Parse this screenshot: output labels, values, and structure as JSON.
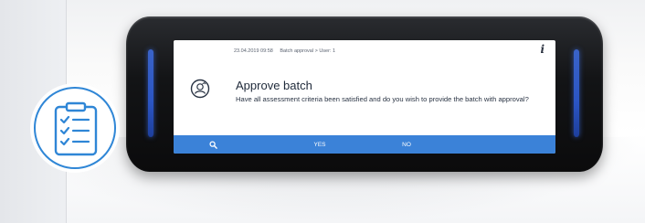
{
  "screen": {
    "status": {
      "datetime": "23.04.2019 09:58",
      "context": "Batch approval > User: 1"
    },
    "info_icon": "i",
    "dialog": {
      "icon": "user-approval-icon",
      "title": "Approve batch",
      "message": "Have all assessment criteria been satisfied and do you wish to provide the batch with approval?"
    },
    "actions": {
      "search_icon": "search-icon",
      "yes_label": "YES",
      "no_label": "NO"
    }
  },
  "badge": {
    "icon": "checklist-clipboard-icon"
  },
  "colors": {
    "accent": "#3b82d8",
    "led": "#2b55c4",
    "badge_border": "#2f86d6"
  }
}
